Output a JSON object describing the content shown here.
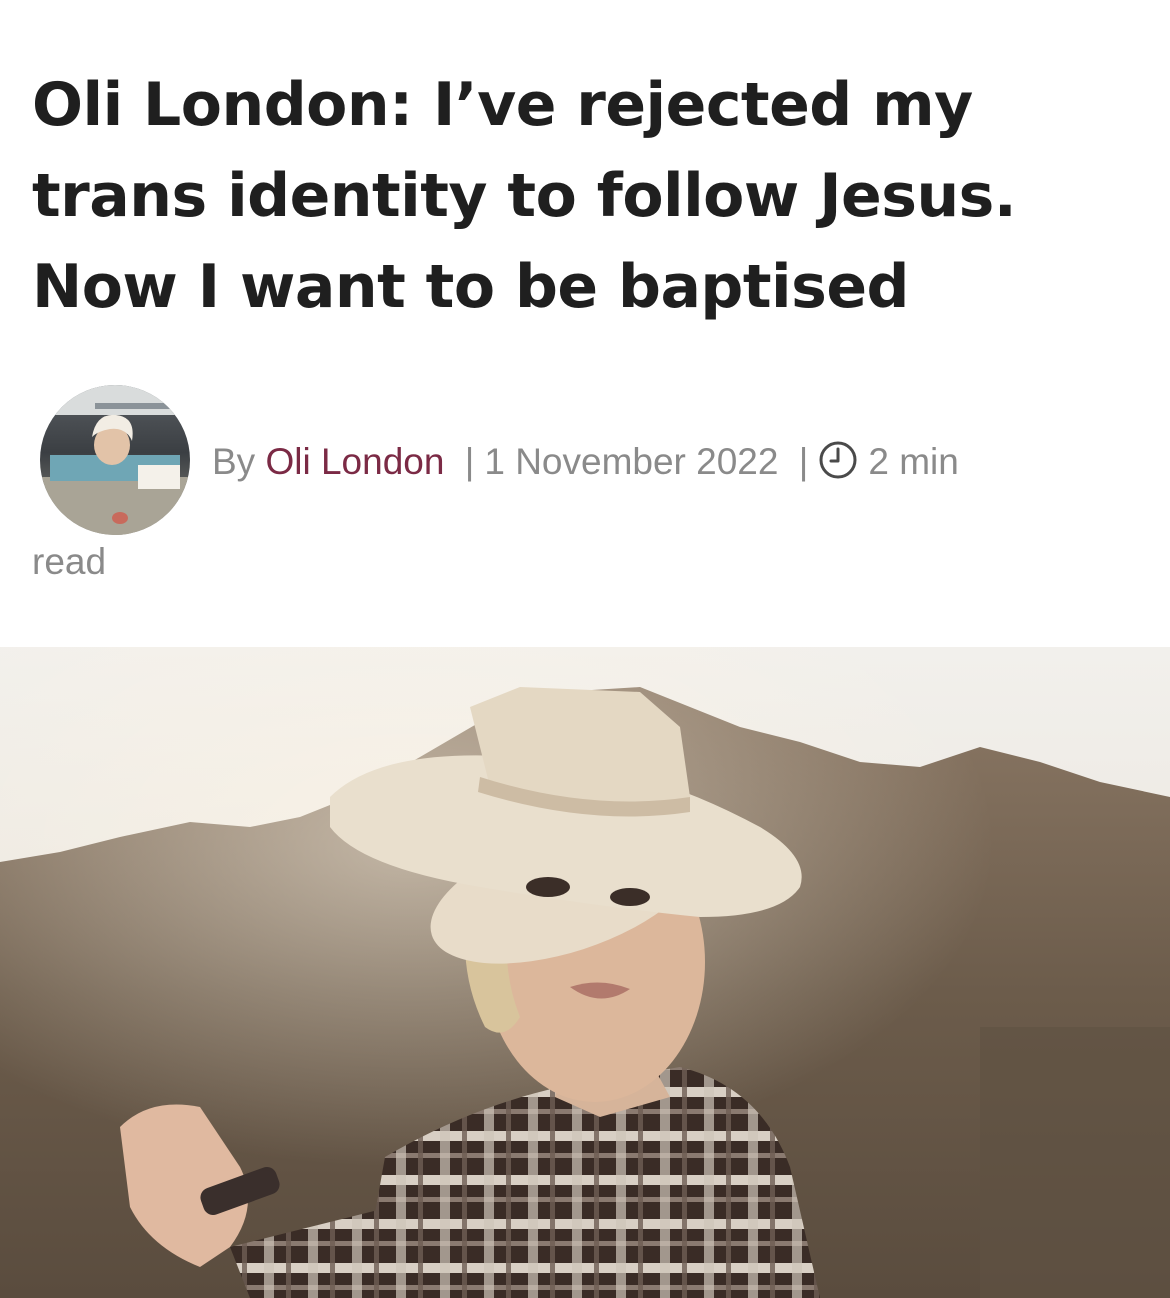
{
  "article": {
    "title": "Oli London: I’ve rejected my trans identity to follow Jesus. Now I want to be baptised",
    "byline": {
      "by": "By",
      "author": "Oli London",
      "separator": "|",
      "date": "1 November 2022",
      "read_time": "2 min",
      "read_word": "read",
      "clock_icon": "clock-icon"
    }
  },
  "colors": {
    "title": "#1f1f1f",
    "meta": "#8a8a8a",
    "author": "#7b2a45"
  }
}
